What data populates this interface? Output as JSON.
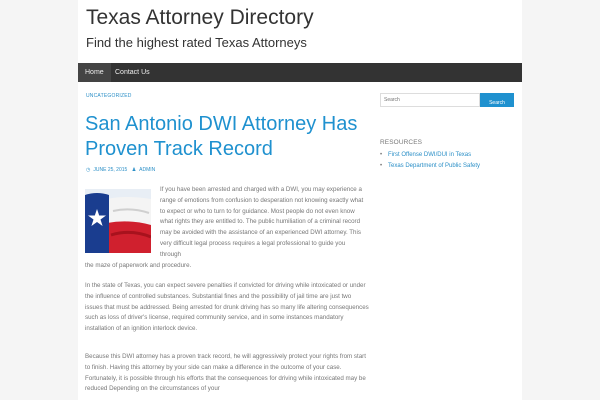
{
  "site": {
    "title": "Texas Attorney Directory",
    "description": "Find the highest rated Texas Attorneys"
  },
  "nav": {
    "items": [
      "Home",
      "Contact Us"
    ]
  },
  "post": {
    "category": "UNCATEGORIZED",
    "title": "San Antonio DWI Attorney Has Proven Track Record",
    "date": "JUNE 25, 2015",
    "author": "ADMIN",
    "paragraph1_wrap": "If you have been arrested and charged with a DWI, you may experience a range of emotions from confusion to desperation not knowing exactly what to expect or who to turn to for guidance. Most people do not even know what rights they are entitled to. The public humiliation of a criminal record may be avoided with the assistance of an experienced DWI attorney. This very difficult legal process requires a legal professional to guide you through",
    "paragraph1_end": "the maze of paperwork and procedure.",
    "paragraph2": "In the state of Texas, you can expect severe penalties if convicted for driving while intoxicated or under the influence of controlled substances. Substantial fines and the possibility of jail time are just two issues that must be addressed. Being arrested for drunk driving has so many life altering consequences such as loss of driver's license, required community service, and in some instances mandatory installation of an ignition interlock device.",
    "paragraph3": "Because this DWI attorney has a proven track record, he will aggressively protect your rights from start to finish. Having this attorney by your side can make a difference in the outcome of your case. Fortunately, it is possible through his efforts that the consequences for driving while intoxicated may be reduced Depending on the circumstances of your"
  },
  "sidebar": {
    "search_placeholder": "Search",
    "search_button": "Search",
    "resources_title": "RESOURCES",
    "resources": [
      "First Offense DWI/DUI in Texas",
      "Texas Department of Public Safety"
    ]
  },
  "icons": {
    "date": "clock-icon",
    "author": "user-icon"
  },
  "colors": {
    "accent": "#1f91cf",
    "nav_bg": "#333333"
  }
}
